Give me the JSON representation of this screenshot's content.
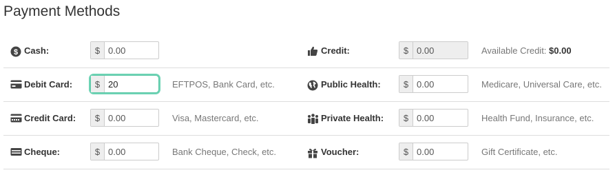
{
  "title": "Payment Methods",
  "currency_symbol": "$",
  "rows": [
    {
      "left": {
        "icon": "dollar-circle-icon",
        "label": "Cash:",
        "value": "0.00",
        "hint": ""
      },
      "right": {
        "icon": "thumbs-up-icon",
        "label": "Credit:",
        "value": "0.00",
        "readonly": true,
        "hint_prefix": "Available Credit:",
        "hint_value": "$0.00"
      }
    },
    {
      "left": {
        "icon": "card-icon",
        "label": "Debit Card:",
        "value": "20",
        "focused": true,
        "hint": "EFTPOS, Bank Card, etc."
      },
      "right": {
        "icon": "globe-icon",
        "label": "Public Health:",
        "value": "0.00",
        "hint": "Medicare, Universal Care, etc."
      }
    },
    {
      "left": {
        "icon": "credit-card-icon",
        "label": "Credit Card:",
        "value": "0.00",
        "hint": "Visa, Mastercard, etc."
      },
      "right": {
        "icon": "people-icon",
        "label": "Private Health:",
        "value": "0.00",
        "hint": "Health Fund, Insurance, etc."
      }
    },
    {
      "left": {
        "icon": "cheque-icon",
        "label": "Cheque:",
        "value": "0.00",
        "hint": "Bank Cheque, Check, etc."
      },
      "right": {
        "icon": "gift-icon",
        "label": "Voucher:",
        "value": "0.00",
        "hint": "Gift Certificate, etc."
      }
    }
  ]
}
